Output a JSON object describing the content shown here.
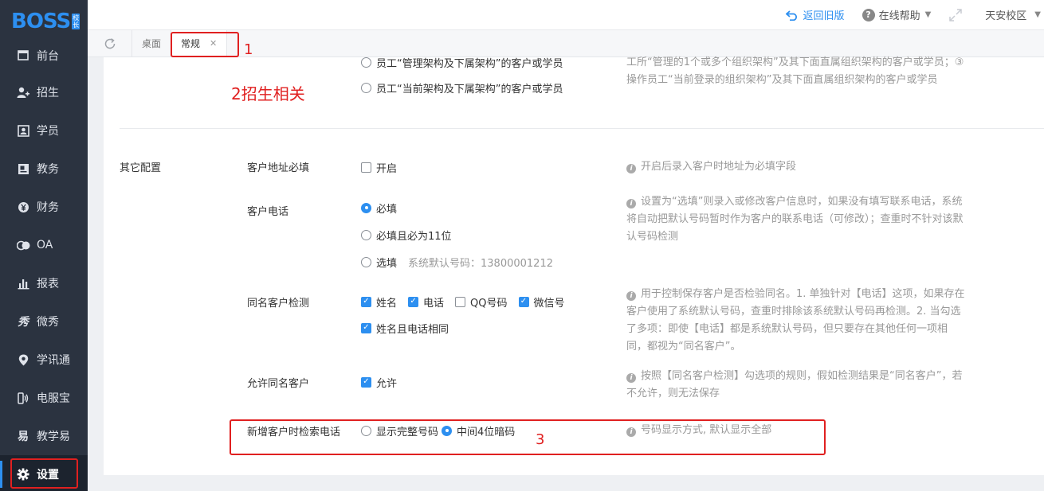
{
  "brand": {
    "logo": "BOSS",
    "badge_top": "校",
    "badge_bottom": "长"
  },
  "sidebar": {
    "items": [
      {
        "label": "前台",
        "icon": "reception-icon"
      },
      {
        "label": "招生",
        "icon": "user-add-icon"
      },
      {
        "label": "学员",
        "icon": "student-card-icon"
      },
      {
        "label": "教务",
        "icon": "book-icon"
      },
      {
        "label": "财务",
        "icon": "yen-icon"
      },
      {
        "label": "OA",
        "icon": "oa-icon"
      },
      {
        "label": "报表",
        "icon": "bar-chart-icon"
      },
      {
        "label": "微秀",
        "icon": "xiu-icon"
      },
      {
        "label": "学讯通",
        "icon": "location-pin-icon"
      },
      {
        "label": "电服宝",
        "icon": "phone-signal-icon"
      },
      {
        "label": "教学易",
        "icon": "teaching-icon"
      },
      {
        "label": "设置",
        "icon": "gear-icon"
      }
    ]
  },
  "topbar": {
    "back_old": "返回旧版",
    "help": "在线帮助",
    "campus": "天安校区"
  },
  "tabs": [
    {
      "label": "桌面"
    },
    {
      "label": "常规"
    }
  ],
  "annotations": {
    "one": "1",
    "two": "2招生相关",
    "three": "3"
  },
  "top_section": {
    "options": [
      "员工“管理架构及下属架构”的客户或学员",
      "员工“当前架构及下属架构”的客户或学员"
    ],
    "desc": "工所“管理的1个或多个组织架构”及其下面直属组织架构的客户或学员；③ 操作员工“当前登录的组织架构”及其下面直属组织架构的客户或学员"
  },
  "other_config": {
    "section_label": "其它配置",
    "address": {
      "label": "客户地址必填",
      "option": "开启",
      "desc": "开启后录入客户时地址为必填字段"
    },
    "phone": {
      "label": "客户电话",
      "options": [
        "必填",
        "必填且必为11位",
        "选填"
      ],
      "default_note": "系统默认号码：13800001212",
      "desc": "设置为“选填”则录入或修改客户信息时，如果没有填写联系电话，系统将自动把默认号码暂时作为客户的联系电话（可修改）；查重时不针对该默认号码检测"
    },
    "dup_check": {
      "label": "同名客户检测",
      "options": [
        "姓名",
        "电话",
        "QQ号码",
        "微信号",
        "姓名且电话相同"
      ],
      "desc": "用于控制保存客户是否检验同名。1. 单独针对【电话】这项，如果存在客户使用了系统默认号码，查重时排除该系统默认号码再检测。2. 当勾选了多项：即使【电话】都是系统默认号码，但只要存在其他任何一项相同，都视为“同名客户”。"
    },
    "allow_dup": {
      "label": "允许同名客户",
      "option": "允许",
      "desc": "按照【同名客户检测】勾选项的规则，假如检测结果是“同名客户”，若不允许，则无法保存"
    },
    "search_phone": {
      "label": "新增客户时检索电话",
      "options": [
        "显示完整号码",
        "中间4位暗码"
      ],
      "desc": "号码显示方式, 默认显示全部"
    }
  }
}
